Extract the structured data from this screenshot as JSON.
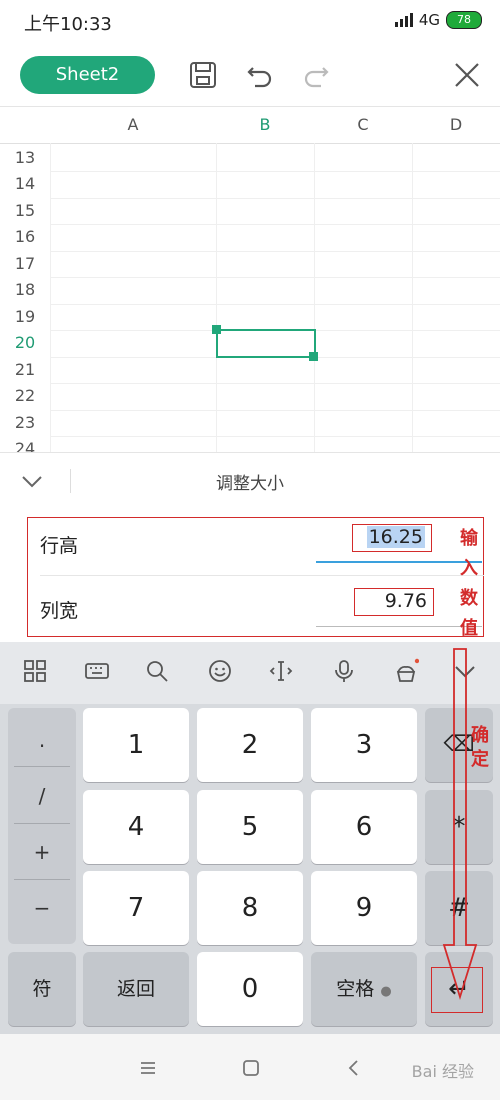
{
  "status_bar": {
    "time": "上午10:33",
    "network": "4G",
    "battery": "78"
  },
  "toolbar": {
    "sheet_tab": "Sheet2",
    "icons": [
      "save-icon",
      "undo-icon",
      "redo-icon",
      "close-icon"
    ]
  },
  "grid": {
    "columns": [
      {
        "label": "A",
        "active": false
      },
      {
        "label": "B",
        "active": true
      },
      {
        "label": "C",
        "active": false
      },
      {
        "label": "D",
        "active": false
      }
    ],
    "rows": [
      "13",
      "14",
      "15",
      "16",
      "17",
      "18",
      "19",
      "20",
      "21",
      "22",
      "23",
      "24"
    ],
    "active_row": "20",
    "selected_cell": "B20"
  },
  "resize_panel": {
    "title": "调整大小",
    "row_height_label": "行高",
    "row_height_value": "16.25",
    "col_width_label": "列宽",
    "col_width_value": "9.76"
  },
  "annotations": {
    "input_value": [
      "输",
      "入",
      "数",
      "值"
    ],
    "confirm": [
      "确",
      "定"
    ]
  },
  "keyboard": {
    "toolbar_icons": [
      "grid-icon",
      "keyboard-icon",
      "search-icon",
      "emoji-icon",
      "cursor-icon",
      "mic-icon",
      "cake-icon",
      "chevron-down-icon"
    ],
    "symbols": [
      ".",
      "/",
      "+",
      "−"
    ],
    "digits": [
      [
        "1",
        "2",
        "3"
      ],
      [
        "4",
        "5",
        "6"
      ],
      [
        "7",
        "8",
        "9"
      ]
    ],
    "right_keys": [
      "⌫",
      "*",
      "#"
    ],
    "bottom": {
      "fu": "符",
      "back": "返回",
      "zero": "0",
      "space": "空格",
      "enter": "↵"
    }
  },
  "watermark": "Bai 经验"
}
